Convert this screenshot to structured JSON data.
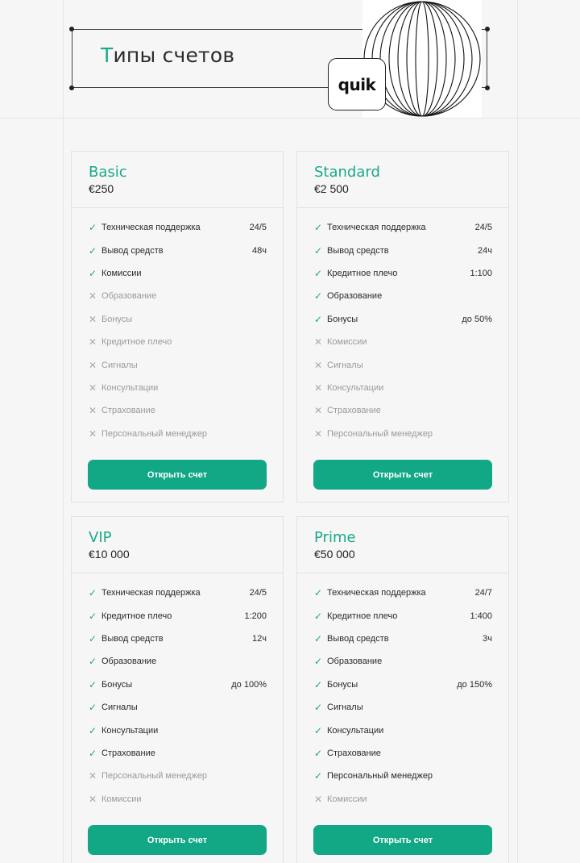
{
  "header": {
    "title_first": "Т",
    "title_rest": "ипы счетов",
    "logo_text": "quik"
  },
  "cards": [
    {
      "name": "Basic",
      "price": "€250",
      "features": [
        {
          "label": "Техническая поддержка",
          "value": "24/5",
          "enabled": true
        },
        {
          "label": "Вывод средств",
          "value": "48ч",
          "enabled": true
        },
        {
          "label": "Комиссии",
          "value": "",
          "enabled": true
        },
        {
          "label": "Образование",
          "value": "",
          "enabled": false
        },
        {
          "label": "Бонусы",
          "value": "",
          "enabled": false
        },
        {
          "label": "Кредитное плечо",
          "value": "",
          "enabled": false
        },
        {
          "label": "Сигналы",
          "value": "",
          "enabled": false
        },
        {
          "label": "Консультации",
          "value": "",
          "enabled": false
        },
        {
          "label": "Страхование",
          "value": "",
          "enabled": false
        },
        {
          "label": "Персональный менеджер",
          "value": "",
          "enabled": false
        }
      ],
      "button": "Открыть счет"
    },
    {
      "name": "Standard",
      "price": "€2 500",
      "features": [
        {
          "label": "Техническая поддержка",
          "value": "24/5",
          "enabled": true
        },
        {
          "label": "Вывод средств",
          "value": "24ч",
          "enabled": true
        },
        {
          "label": "Кредитное плечо",
          "value": "1:100",
          "enabled": true
        },
        {
          "label": "Образование",
          "value": "",
          "enabled": true
        },
        {
          "label": "Бонусы",
          "value": "до 50%",
          "enabled": true
        },
        {
          "label": "Комиссии",
          "value": "",
          "enabled": false
        },
        {
          "label": "Сигналы",
          "value": "",
          "enabled": false
        },
        {
          "label": "Консультации",
          "value": "",
          "enabled": false
        },
        {
          "label": "Страхование",
          "value": "",
          "enabled": false
        },
        {
          "label": "Персональный менеджер",
          "value": "",
          "enabled": false
        }
      ],
      "button": "Открыть счет"
    },
    {
      "name": "VIP",
      "price": "€10 000",
      "features": [
        {
          "label": "Техническая поддержка",
          "value": "24/5",
          "enabled": true
        },
        {
          "label": "Кредитное плечо",
          "value": "1:200",
          "enabled": true
        },
        {
          "label": "Вывод средств",
          "value": "12ч",
          "enabled": true
        },
        {
          "label": "Образование",
          "value": "",
          "enabled": true
        },
        {
          "label": "Бонусы",
          "value": "до 100%",
          "enabled": true
        },
        {
          "label": "Сигналы",
          "value": "",
          "enabled": true
        },
        {
          "label": "Консультации",
          "value": "",
          "enabled": true
        },
        {
          "label": "Страхование",
          "value": "",
          "enabled": true
        },
        {
          "label": "Персональный менеджер",
          "value": "",
          "enabled": false
        },
        {
          "label": "Комиссии",
          "value": "",
          "enabled": false
        }
      ],
      "button": "Открыть счет"
    },
    {
      "name": "Prime",
      "price": "€50 000",
      "features": [
        {
          "label": "Техническая поддержка",
          "value": "24/7",
          "enabled": true
        },
        {
          "label": "Кредитное плечо",
          "value": "1:400",
          "enabled": true
        },
        {
          "label": "Вывод средств",
          "value": "3ч",
          "enabled": true
        },
        {
          "label": "Образование",
          "value": "",
          "enabled": true
        },
        {
          "label": "Бонусы",
          "value": "до 150%",
          "enabled": true
        },
        {
          "label": "Сигналы",
          "value": "",
          "enabled": true
        },
        {
          "label": "Консультации",
          "value": "",
          "enabled": true
        },
        {
          "label": "Страхование",
          "value": "",
          "enabled": true
        },
        {
          "label": "Персональный менеджер",
          "value": "",
          "enabled": true
        },
        {
          "label": "Комиссии",
          "value": "",
          "enabled": false
        }
      ],
      "button": "Открыть счет"
    }
  ],
  "icons": {
    "enabled": "check-icon",
    "disabled": "cross-icon"
  },
  "colors": {
    "accent": "#1aa88b",
    "button": "#12a785",
    "disabled": "#a9a9a9"
  }
}
